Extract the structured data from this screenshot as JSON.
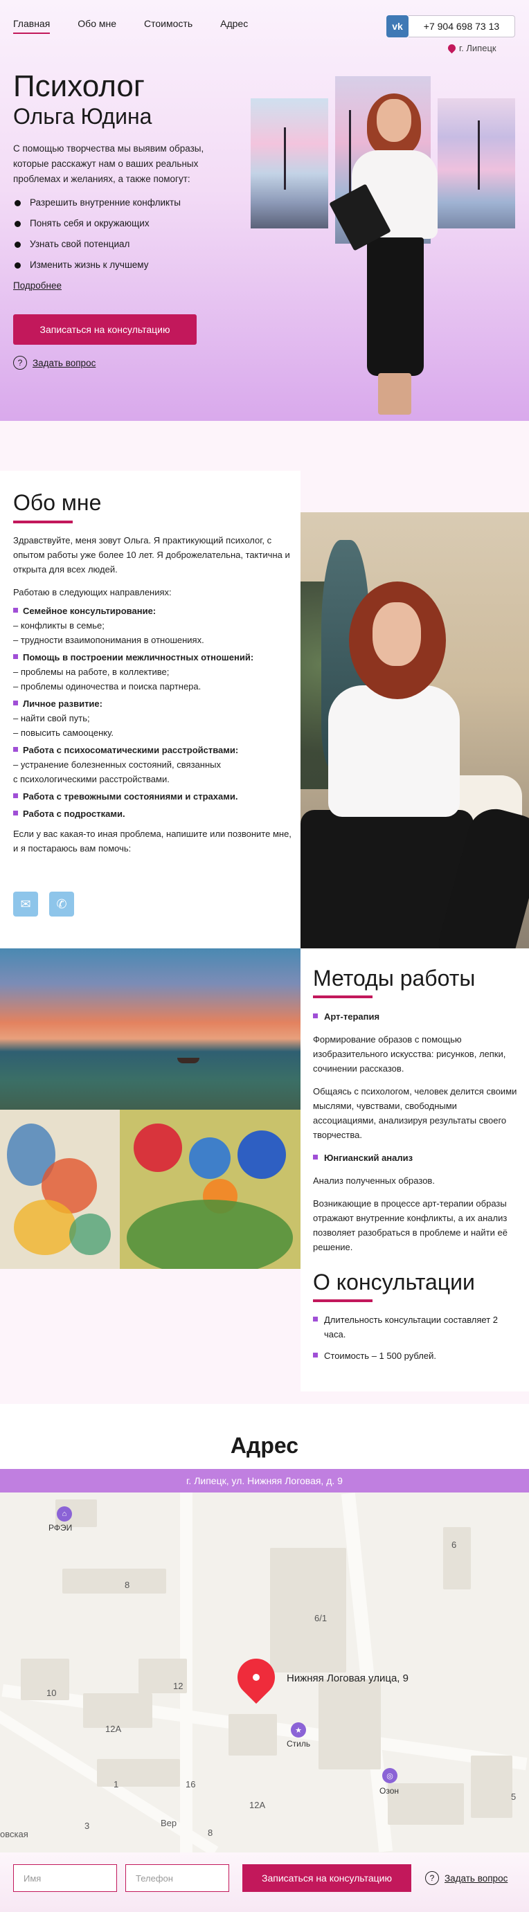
{
  "nav": {
    "items": [
      {
        "label": "Главная",
        "active": true
      },
      {
        "label": "Обо мне",
        "active": false
      },
      {
        "label": "Стоимость",
        "active": false
      },
      {
        "label": "Адрес",
        "active": false
      }
    ],
    "vk_label": "vk",
    "phone": "+7 904 698 73 13",
    "city": "г. Липецк"
  },
  "hero": {
    "title": "Психолог",
    "name": "Ольга Юдина",
    "intro": "С помощью творчества мы выявим образы, которые расскажут нам о ваших реальных проблемах и желаниях, а также помогут:",
    "bullets": [
      "Разрешить внутренние конфликты",
      "Понять себя и окружающих",
      "Узнать свой потенциал",
      "Изменить жизнь к лучшему"
    ],
    "more_link": "Подробнее",
    "cta": "Записаться на консультацию",
    "ask": "Задать вопрос"
  },
  "about": {
    "title": "Обо мне",
    "intro": "Здравствуйте, меня зовут Ольга. Я практикующий психолог, с опытом работы уже более 10 лет. Я доброжелательна, тактична и открыта для всех людей.",
    "directions_intro": "Работаю в следующих направлениях:",
    "directions": [
      {
        "head": "Семейное консультирование:",
        "lines": [
          "– конфликты в семье;",
          "– трудности взаимопонимания в отношениях."
        ]
      },
      {
        "head": "Помощь в построении межличностных отношений:",
        "lines": [
          "– проблемы на работе, в коллективе;",
          "– проблемы одиночества и поиска партнера."
        ]
      },
      {
        "head": "Личное развитие:",
        "lines": [
          "– найти свой путь;",
          "– повысить самооценку."
        ]
      },
      {
        "head": "Работа с психосоматическими расстройствами:",
        "lines": [
          "– устранение болезненных состояний, связанных",
          "с психологическими расстройствами."
        ]
      },
      {
        "head": "Работа с тревожными состояниями и страхами.",
        "lines": []
      },
      {
        "head": "Работа с подростками.",
        "lines": []
      }
    ],
    "outro": "Если у вас какая-то иная проблема, напишите или позвоните мне, и я постараюсь вам помочь:",
    "icons": [
      "mail-icon",
      "phone-icon"
    ]
  },
  "methods": {
    "title": "Методы работы",
    "art_head": "Арт-терапия",
    "art_p1": "Формирование образов с помощью изобразительного искусства: рисунков, лепки, сочинении рассказов.",
    "art_p2": "Общаясь с психологом, человек делится своими мыслями, чувствами, свободными ассоциациями, анализируя результаты своего творчества.",
    "jung_head": "Юнгианский анализ",
    "jung_p1": "Анализ полученных образов.",
    "jung_p2": "Возникающие в процессе арт-терапии образы отражают внутренние конфликты, а их анализ позволяет разобраться в проблеме и найти её решение."
  },
  "consult": {
    "title": "О консультации",
    "items": [
      "Длительность консультации составляет 2 часа.",
      "Стоимость – 1 500 рублей."
    ]
  },
  "address": {
    "title": "Адрес",
    "line": "г. Липецк, ул. Нижняя Логовая, д. 9",
    "map_place": "Нижняя Логовая улица, 9",
    "poi": {
      "style": "Стиль",
      "ozon": "Озон",
      "rfei": "РФЭИ"
    },
    "numbers": [
      "8",
      "6",
      "6/1",
      "10",
      "12",
      "12А",
      "1",
      "16",
      "12А",
      "3",
      "8",
      "5"
    ],
    "street_partial": "Вер",
    "partial_left": "овская"
  },
  "form": {
    "name_placeholder": "Имя",
    "phone_placeholder": "Телефон",
    "submit": "Записаться на консультацию",
    "ask": "Задать вопрос"
  },
  "colors": {
    "accent": "#c2185b",
    "marker": "#a04fd6",
    "address_bar": "#c07fe0"
  }
}
